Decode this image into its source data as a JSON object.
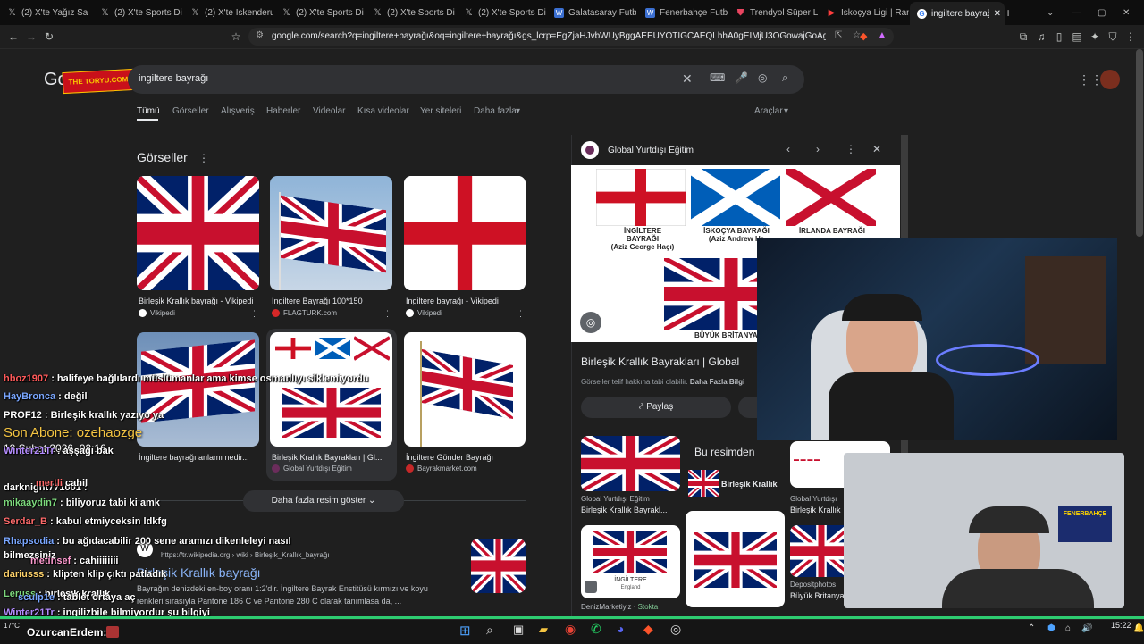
{
  "tabs": [
    {
      "label": "(2) X'te Yağız Sabu",
      "icon": "x-logo-icon"
    },
    {
      "label": "(2) X'te Sports Digi",
      "icon": "x-logo-icon"
    },
    {
      "label": "(2) X'te İskenderun",
      "icon": "x-logo-icon"
    },
    {
      "label": "(2) X'te Sports Digi",
      "icon": "x-logo-icon"
    },
    {
      "label": "(2) X'te Sports Digi",
      "icon": "x-logo-icon"
    },
    {
      "label": "(2) X'te Sports Digi",
      "icon": "x-logo-icon"
    },
    {
      "label": "Galatasaray Futbol",
      "icon": "wiki-icon"
    },
    {
      "label": "Fenerbahçe Futbol",
      "icon": "wiki-icon"
    },
    {
      "label": "Trendyol Süper Lig",
      "icon": "shield-icon"
    },
    {
      "label": "İskoçya Ligi | Range",
      "icon": "youtube-icon"
    },
    {
      "label": "ingiltere bayrağ",
      "icon": "google-icon",
      "active": true
    }
  ],
  "url": "google.com/search?q=ingiltere+bayrağı&oq=ingiltere+bayrağı&gs_lcrp=EgZjaHJvbWUyBggAEEUYOTIGCAEQLhhA0gEIMjU3OGowajGoAgCwAgA&s...",
  "search": {
    "query": "ingiltere bayrağı",
    "logo": "Google",
    "overlay_logo": "THE TORYU.COM"
  },
  "nav": [
    "Tümü",
    "Görseller",
    "Alışveriş",
    "Haberler",
    "Videolar",
    "Kısa videolar",
    "Yer siteleri",
    "Daha fazla"
  ],
  "tools_label": "Araçlar",
  "images_section": {
    "title": "Görseller",
    "cards": [
      {
        "caption": "Birleşik Krallık bayrağı - Vikipedi",
        "source": "Vikipedi"
      },
      {
        "caption": "İngiltere Bayrağı 100*150",
        "source": "FLAGTURK.com"
      },
      {
        "caption": "İngiltere bayrağı - Vikipedi",
        "source": "Vikipedi"
      },
      {
        "caption": "İngiltere bayrağı anlamı nedir...",
        "source": ""
      },
      {
        "caption": "Birleşik Krallık Bayrakları | Gl...",
        "source": "Global Yurtdışı Eğitim"
      },
      {
        "caption": "İngiltere Gönder Bayrağı",
        "source": "Bayrakmarket.com"
      }
    ],
    "more_button": "Daha fazla resim göster"
  },
  "result": {
    "url": "https://tr.wikipedia.org › wiki › Birleşik_Krallık_bayrağı",
    "title": "Birleşik Krallık bayrağı",
    "snippet1": "Bayrağın denizdeki en-boy oranı 1:2'dir. İngiltere Bayrak Enstitüsü kırmızı ve koyu",
    "snippet2": "renkleri sırasıyla Pantone 186 C ve Pantone 280 C olarak tanımlasa da, ..."
  },
  "panel": {
    "source": "Global Yurtdışı Eğitim",
    "flags": [
      {
        "name": "İNGİLTERE BAYRAĞI",
        "sub": "(Aziz George Haçı)"
      },
      {
        "name": "İSKOÇYA BAYRAĞI",
        "sub": "(Aziz Andrew Ha"
      },
      {
        "name": "İRLANDA BAYRAĞI",
        "sub": ""
      }
    ],
    "big_flag_label": "BÜYÜK BRİTANYA BA",
    "title": "Birleşik Krallık Bayrakları | Global",
    "notice": "Görseller telif hakkına tabi olabilir.",
    "notice_link": "Daha Fazla Bilgi",
    "share": "Paylaş",
    "in_image": "Bu resimden",
    "in_image_item": "Birleşik Krallık",
    "thumbs": [
      {
        "source": "Global Yurtdışı Eğitim",
        "caption": "Birleşik Krallık Bayrakl..."
      },
      {
        "source": "Global Yurtdışı",
        "caption": "Birleşik Krallık"
      },
      {
        "source": "DenizMarketiyiz",
        "caption": "Stokta",
        "label": "İNGİLTERE",
        "sub": "England"
      },
      {
        "source": "Depositphotos",
        "caption": "Büyük Britanya"
      }
    ]
  },
  "chat": [
    {
      "user": "hboz1907",
      "msg": "halifeye bağlılardı müslümanlar ama kimse osmanlıyı siklemiyordu",
      "color": "#ff5a5a"
    },
    {
      "user": "HayBronca",
      "msg": "değil",
      "color": "#7aa7ff"
    },
    {
      "user": "PROF12",
      "msg": "Birleşik krallık yazıyo ya",
      "color": "#ffffff"
    },
    {
      "user": "Winter21Tr",
      "msg": "aşşağı bak",
      "color": "#b48cff"
    },
    {
      "user": "darknight771001",
      "msg": "",
      "color": "#ffffff"
    },
    {
      "user": "mertli",
      "msg": "cahil",
      "color": "#ff6b6b"
    },
    {
      "user": "mikaaydin7",
      "msg": "biliyoruz tabi ki amk",
      "color": "#7dd87d"
    },
    {
      "user": "Serdar_B",
      "msg": "kabul etmiyceksin ldkfg",
      "color": "#ff6b6b"
    },
    {
      "user": "Rhapsodia",
      "msg": "bu ağıdacabilir 200 sene aramızı dikenleleyi nasıl",
      "color": "#7aa7ff"
    },
    {
      "user": "bilmezsiniz",
      "msg": "",
      "color": "#ffffff"
    },
    {
      "user": "metinsef",
      "msg": "cahiiiiiiii",
      "color": "#ff9bd0"
    },
    {
      "user": "dariusss",
      "msg": "klipten klip çıktı patladık",
      "color": "#ffd36b"
    },
    {
      "user": "Leruss",
      "msg": "birleşik krallık",
      "color": "#7dd87d"
    },
    {
      "user": "sculp1e",
      "msg": "tablet ortaya aç",
      "color": "#7aa7ff"
    },
    {
      "user": "Winter21Tr",
      "msg": "ingilizbile bilmiyordur şu bilgiyi",
      "color": "#b48cff"
    }
  ],
  "sub_alert": {
    "label": "Son Abone: ozehaozge",
    "date": "18 Şubat 2026, 02:16"
  },
  "bottom_user": "OzurcanErdem:",
  "taskbar": {
    "time": "15:22",
    "temp": "17°C"
  },
  "colors": {
    "flag_blue": "#012169",
    "flag_red": "#C8102E",
    "accent": "#8ab4f8"
  }
}
